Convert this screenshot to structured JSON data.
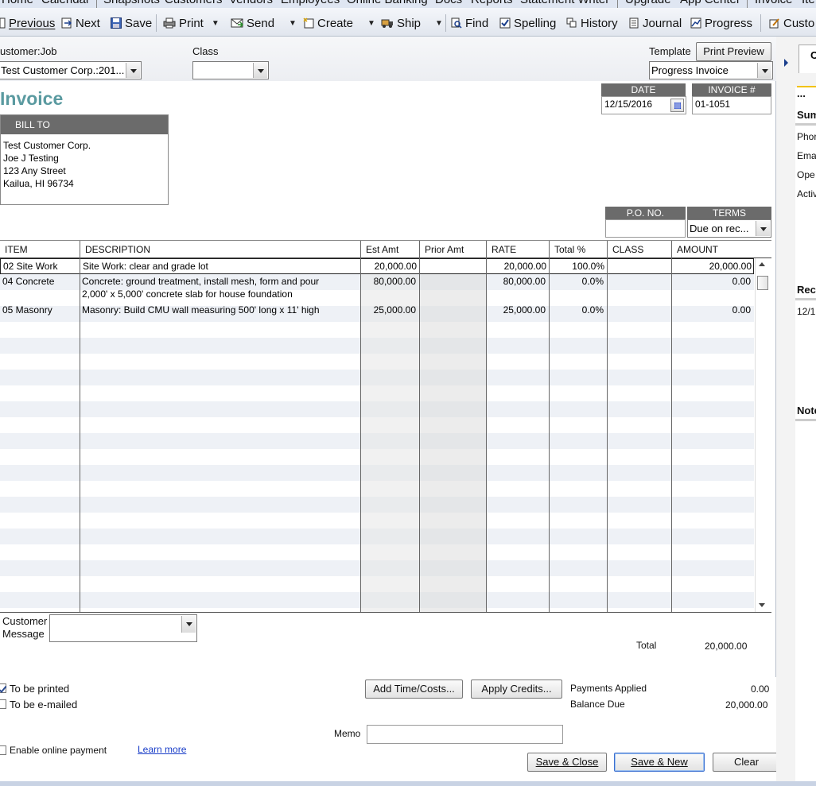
{
  "menu": [
    "Home",
    "Calendar",
    "Snapshots",
    "Customers",
    "Vendors",
    "Employees",
    "Online Banking",
    "Docs",
    "Reports",
    "Statement Writer",
    "Upgrade",
    "App Center",
    "Invoice",
    "Ite"
  ],
  "toolbar": {
    "previous": "Previous",
    "next": "Next",
    "save": "Save",
    "print": "Print",
    "send": "Send",
    "create": "Create",
    "ship": "Ship",
    "find": "Find",
    "spelling": "Spelling",
    "history": "History",
    "journal": "Journal",
    "progress": "Progress",
    "customize": "Custo"
  },
  "header": {
    "customer_job_label": "ustomer:Job",
    "customer_job_value": "Test Customer Corp.:201...",
    "class_label": "Class",
    "class_value": "",
    "template_label": "Template",
    "print_preview": "Print Preview",
    "template_value": "Progress Invoice"
  },
  "invoice": {
    "title": "Invoice",
    "date_label": "DATE",
    "date_value": "12/15/2016",
    "invoice_no_label": "INVOICE #",
    "invoice_no_value": "01-1051",
    "bill_to_label": "BILL TO",
    "bill_to": [
      "Test Customer Corp.",
      "Joe J Testing",
      "123 Any Street",
      "Kailua, HI 96734"
    ],
    "po_label": "P.O. NO.",
    "po_value": "",
    "terms_label": "TERMS",
    "terms_value": "Due on rec..."
  },
  "table": {
    "columns": [
      "ITEM",
      "DESCRIPTION",
      "Est Amt",
      "Prior Amt",
      "RATE",
      "Total %",
      "CLASS",
      "AMOUNT"
    ],
    "rows": [
      {
        "item": "02 Site Work",
        "desc1": "Site Work: clear and grade lot",
        "desc2": "",
        "est": "20,000.00",
        "prior": "",
        "rate": "20,000.00",
        "pct": "100.0%",
        "class": "",
        "amount": "20,000.00"
      },
      {
        "item": "04 Concrete",
        "desc1": "Concrete: ground treatment, install mesh, form and pour",
        "desc2": "2,000' x 5,000' concrete slab for house foundation",
        "est": "80,000.00",
        "prior": "",
        "rate": "80,000.00",
        "pct": "0.0%",
        "class": "",
        "amount": "0.00"
      },
      {
        "item": "05 Masonry",
        "desc1": "Masonry:  Build CMU wall measuring 500' long x 11' high",
        "desc2": "",
        "est": "25,000.00",
        "prior": "",
        "rate": "25,000.00",
        "pct": "0.0%",
        "class": "",
        "amount": "0.00"
      }
    ]
  },
  "footer": {
    "customer_message_label1": "Customer",
    "customer_message_label2": "Message",
    "total_label": "Total",
    "total_value": "20,000.00",
    "to_be_printed": "To be printed",
    "to_be_emailed": "To be e-mailed",
    "add_time_costs": "Add Time/Costs...",
    "apply_credits": "Apply Credits...",
    "payments_applied_label": "Payments Applied",
    "payments_applied_value": "0.00",
    "balance_due_label": "Balance Due",
    "balance_due_value": "20,000.00",
    "enable_online_payment": "Enable online payment",
    "learn_more": "Learn more",
    "memo_label": "Memo",
    "save_close": "Save & Close",
    "save_new": "Save & New",
    "clear": "Clear"
  },
  "right_panel": {
    "tab": "C",
    "dots": "...",
    "labels": [
      "Sum",
      "Phor",
      "Ema",
      "Ope",
      "Activ",
      "Rec",
      "12/1",
      "Note"
    ]
  },
  "colors": {
    "title": "#5a9aa0",
    "header_gray": "#6b6b6b",
    "row_stripe": "#eef1f6",
    "accent_yellow": "#f2c200"
  }
}
